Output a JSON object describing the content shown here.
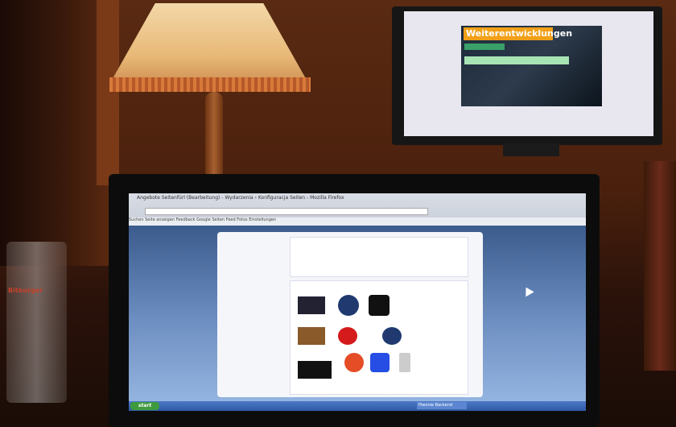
{
  "monitor": {
    "banner_title": "Weiterentwicklungen"
  },
  "laptop": {
    "browser_title": "Angebote Seitenfürl (Bearbeitung) - Wydarzenia › Konfiguracja Seiten - Mozilla Firefox",
    "bookmarks": "Suchen   Seite anzeigen   Feedback   Google Seiten   Feed   Fotos   Einstellungen",
    "taskbar_start": "start",
    "taskbar_tab": "Piwonie Backend"
  },
  "glass": {
    "label": "Bitburger"
  }
}
